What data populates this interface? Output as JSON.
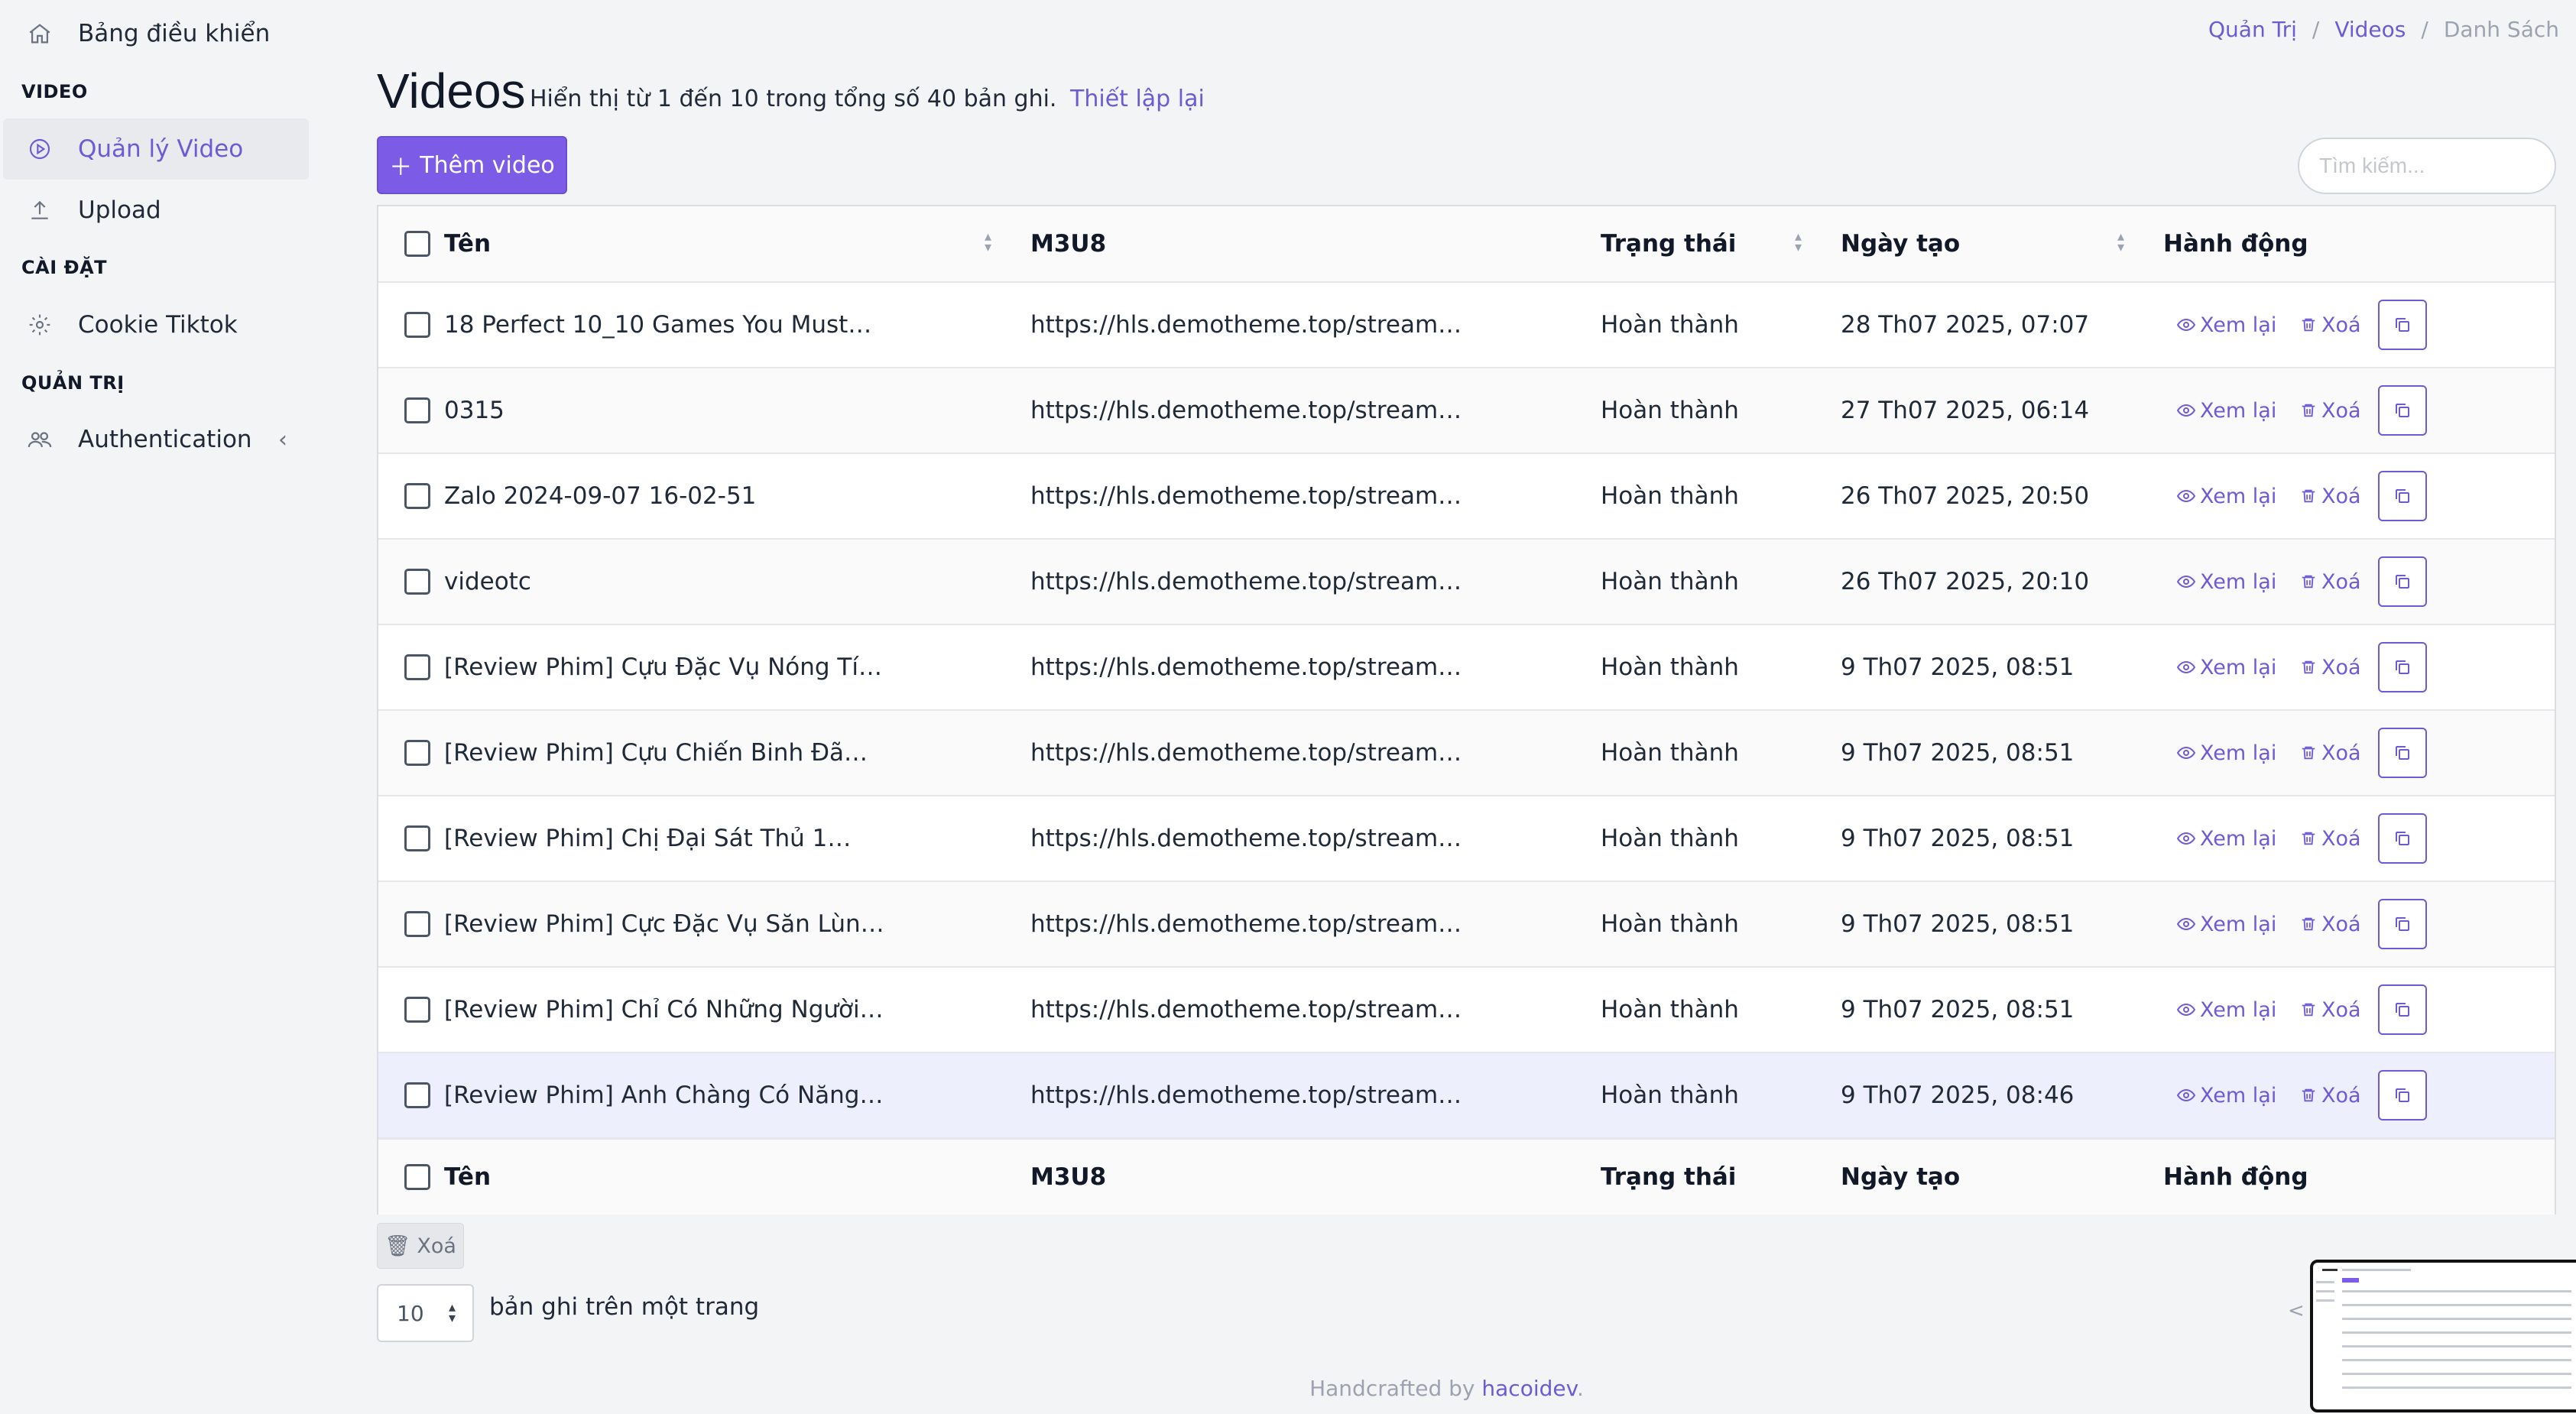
{
  "sidebar": {
    "dashboard": "Bảng điều khiển",
    "sections": {
      "video": "VIDEO",
      "settings": "CÀI ĐẶT",
      "admin": "QUẢN TRỊ"
    },
    "items": {
      "manage_video": "Quản lý Video",
      "upload": "Upload",
      "cookie": "Cookie Tiktok",
      "auth": "Authentication"
    }
  },
  "breadcrumb": {
    "admin": "Quản Trị",
    "videos": "Videos",
    "list": "Danh Sách"
  },
  "header": {
    "title": "Videos",
    "info": "Hiển thị từ 1 đến 10 trong tổng số 40 bản ghi.",
    "reset": "Thiết lập lại",
    "add_button": "Thêm video",
    "search_placeholder": "Tìm kiếm..."
  },
  "table": {
    "columns": {
      "name": "Tên",
      "m3u8": "M3U8",
      "status": "Trạng thái",
      "created": "Ngày tạo",
      "actions": "Hành động"
    },
    "action_labels": {
      "review": "Xem lại",
      "delete": "Xoá"
    },
    "rows": [
      {
        "name": "18 Perfect 10_10 Games You Must…",
        "m3u8": "https://hls.demotheme.top/stream…",
        "status": "Hoàn thành",
        "created": "28 Th07 2025, 07:07"
      },
      {
        "name": "0315",
        "m3u8": "https://hls.demotheme.top/stream…",
        "status": "Hoàn thành",
        "created": "27 Th07 2025, 06:14"
      },
      {
        "name": "Zalo 2024-09-07 16-02-51",
        "m3u8": "https://hls.demotheme.top/stream…",
        "status": "Hoàn thành",
        "created": "26 Th07 2025, 20:50"
      },
      {
        "name": "videotc",
        "m3u8": "https://hls.demotheme.top/stream…",
        "status": "Hoàn thành",
        "created": "26 Th07 2025, 20:10"
      },
      {
        "name": "[Review Phim] Cựu Đặc Vụ Nóng Tí…",
        "m3u8": "https://hls.demotheme.top/stream…",
        "status": "Hoàn thành",
        "created": "9 Th07 2025, 08:51"
      },
      {
        "name": "[Review Phim] Cựu Chiến Binh Đã…",
        "m3u8": "https://hls.demotheme.top/stream…",
        "status": "Hoàn thành",
        "created": "9 Th07 2025, 08:51"
      },
      {
        "name": "[Review Phim] Chị Đại Sát Thủ 1…",
        "m3u8": "https://hls.demotheme.top/stream…",
        "status": "Hoàn thành",
        "created": "9 Th07 2025, 08:51"
      },
      {
        "name": "[Review Phim] Cực Đặc Vụ Săn Lùn…",
        "m3u8": "https://hls.demotheme.top/stream…",
        "status": "Hoàn thành",
        "created": "9 Th07 2025, 08:51"
      },
      {
        "name": "[Review Phim] Chỉ Có Những Người…",
        "m3u8": "https://hls.demotheme.top/stream…",
        "status": "Hoàn thành",
        "created": "9 Th07 2025, 08:51"
      },
      {
        "name": "[Review Phim] Anh Chàng Có Năng…",
        "m3u8": "https://hls.demotheme.top/stream…",
        "status": "Hoàn thành",
        "created": "9 Th07 2025, 08:46"
      }
    ]
  },
  "bulk_delete": "Xoá",
  "per_page": {
    "value": "10",
    "label": "bản ghi trên một trang"
  },
  "footer": {
    "text": "Handcrafted by",
    "brand": "hacoidev",
    "end": "."
  },
  "colors": {
    "accent": "#7c5ce6",
    "link": "#6f5ad6"
  }
}
